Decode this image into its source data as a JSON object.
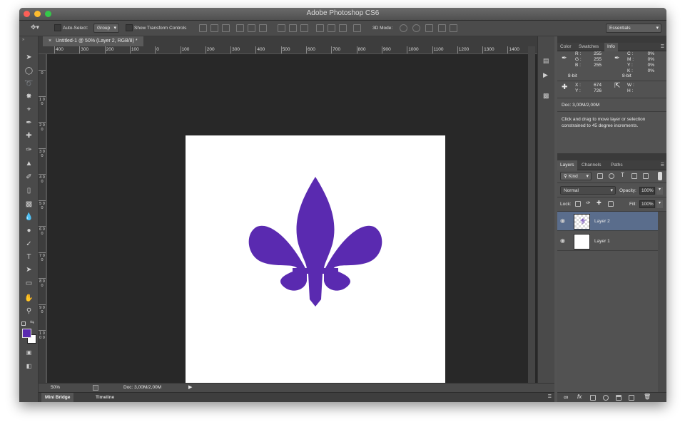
{
  "window": {
    "title": "Adobe Photoshop CS6"
  },
  "options_bar": {
    "auto_select_label": "Auto-Select:",
    "auto_select_value": "Group",
    "show_transform_label": "Show Transform Controls",
    "mode_3d_label": "3D Mode:",
    "workspace_value": "Essentials"
  },
  "document": {
    "tab_label": "Untitled-1 @ 50% (Layer 2, RGB/8) *",
    "tab_close": "×",
    "ruler_h_labels": [
      "400",
      "300",
      "200",
      "100",
      "0",
      "100",
      "200",
      "300",
      "400",
      "500",
      "600",
      "700",
      "800",
      "900",
      "1000",
      "1100",
      "1200",
      "1300",
      "1400"
    ],
    "ruler_v_labels": [
      "0",
      "1 0 0",
      "2 0 0",
      "3 0 0",
      "4 0 0",
      "5 0 0",
      "6 0 0",
      "7 0 0",
      "8 0 0",
      "9 0 0",
      "1 0 0 0"
    ],
    "fleur_color": "#5a2ab0"
  },
  "status": {
    "zoom": "50%",
    "doc_info": "Doc: 3,00M/2,00M"
  },
  "bottom_tabs": [
    "Mini Bridge",
    "Timeline"
  ],
  "info_panel": {
    "tabs": [
      "Color",
      "Swatches",
      "Info"
    ],
    "active_tab": "Info",
    "rgb_labels": [
      "R :",
      "G :",
      "B :"
    ],
    "rgb_values": [
      "255",
      "255",
      "255"
    ],
    "cmyk_labels": [
      "C :",
      "M :",
      "Y :",
      "K :"
    ],
    "cmyk_values": [
      "0%",
      "0%",
      "0%",
      "0%"
    ],
    "bit_depth_left": "8-bit",
    "bit_depth_right": "8-bit",
    "xy_labels": [
      "X :",
      "Y :"
    ],
    "xy_values": [
      "674",
      "726"
    ],
    "wh_labels": [
      "W :",
      "H :"
    ],
    "doc": "Doc: 3,00M/2,00M",
    "hint": "Click and drag to move layer or selection constrained to 45 degree increments."
  },
  "layers_panel": {
    "tabs": [
      "Layers",
      "Channels",
      "Paths"
    ],
    "active_tab": "Layers",
    "filter_value": "Kind",
    "blend_mode": "Normal",
    "opacity_label": "Opacity:",
    "opacity_value": "100%",
    "lock_label": "Lock:",
    "fill_label": "Fill:",
    "fill_value": "100%",
    "layers": [
      {
        "name": "Layer 2",
        "selected": true
      },
      {
        "name": "Layer 1",
        "selected": false
      }
    ]
  },
  "colors": {
    "foreground": "#5a2ab0",
    "background": "#ffffff",
    "accent_selected_layer": "#5a6d8c"
  }
}
